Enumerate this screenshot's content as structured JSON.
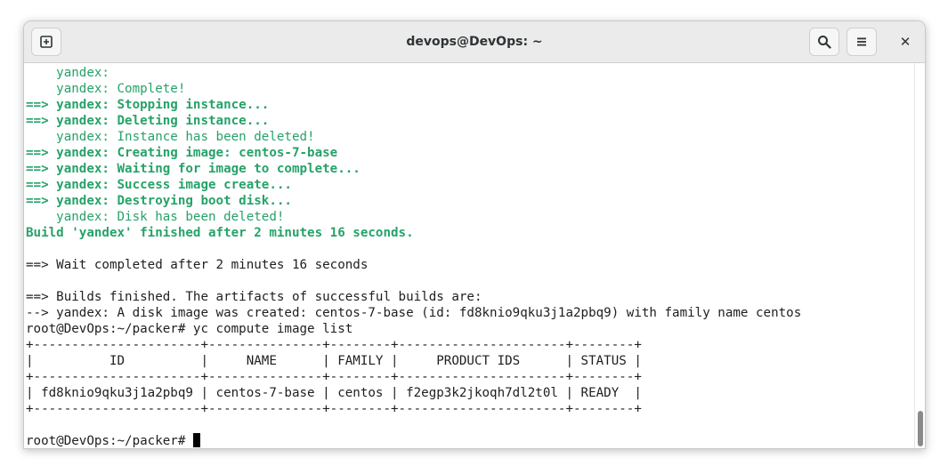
{
  "window": {
    "title": "devops@DevOps: ~"
  },
  "toolbar": {
    "new_tab_icon": "new-tab-icon",
    "search_icon": "search-icon",
    "menu_icon": "hamburger-menu-icon",
    "close_label": "✕"
  },
  "colors": {
    "terminal_green": "#26a269",
    "text": "#1e1e1e",
    "background": "#ffffff"
  },
  "terminal": {
    "lines": [
      {
        "segments": [
          {
            "text": "    yandex:",
            "style": "g"
          }
        ]
      },
      {
        "segments": [
          {
            "text": "    yandex: Complete!",
            "style": "g"
          }
        ]
      },
      {
        "segments": [
          {
            "text": "==> yandex: Stopping instance...",
            "style": "gb"
          }
        ]
      },
      {
        "segments": [
          {
            "text": "==> yandex: Deleting instance...",
            "style": "gb"
          }
        ]
      },
      {
        "segments": [
          {
            "text": "    yandex: Instance has been deleted!",
            "style": "g"
          }
        ]
      },
      {
        "segments": [
          {
            "text": "==> yandex: Creating image: centos-7-base",
            "style": "gb"
          }
        ]
      },
      {
        "segments": [
          {
            "text": "==> yandex: Waiting for image to complete...",
            "style": "gb"
          }
        ]
      },
      {
        "segments": [
          {
            "text": "==> yandex: Success image create...",
            "style": "gb"
          }
        ]
      },
      {
        "segments": [
          {
            "text": "==> yandex: Destroying boot disk...",
            "style": "gb"
          }
        ]
      },
      {
        "segments": [
          {
            "text": "    yandex: Disk has been deleted!",
            "style": "g"
          }
        ]
      },
      {
        "segments": [
          {
            "text": "Build 'yandex' finished after 2 minutes 16 seconds.",
            "style": "gb"
          }
        ]
      },
      {
        "segments": [
          {
            "text": "",
            "style": "n"
          }
        ]
      },
      {
        "segments": [
          {
            "text": "==> Wait completed after 2 minutes 16 seconds",
            "style": "n"
          }
        ]
      },
      {
        "segments": [
          {
            "text": "",
            "style": "n"
          }
        ]
      },
      {
        "segments": [
          {
            "text": "==> Builds finished. The artifacts of successful builds are:",
            "style": "n"
          }
        ]
      },
      {
        "segments": [
          {
            "text": "--> yandex: A disk image was created: centos-7-base (id: fd8knio9qku3j1a2pbq9) with family name centos",
            "style": "n"
          }
        ]
      },
      {
        "segments": [
          {
            "text": "root@DevOps:~/packer# yc compute image list",
            "style": "n"
          }
        ]
      },
      {
        "segments": [
          {
            "text": "+----------------------+---------------+--------+----------------------+--------+",
            "style": "n"
          }
        ]
      },
      {
        "segments": [
          {
            "text": "|          ID          |     NAME      | FAMILY |     PRODUCT IDS      | STATUS |",
            "style": "n"
          }
        ]
      },
      {
        "segments": [
          {
            "text": "+----------------------+---------------+--------+----------------------+--------+",
            "style": "n"
          }
        ]
      },
      {
        "segments": [
          {
            "text": "| fd8knio9qku3j1a2pbq9 | centos-7-base | centos | f2egp3k2jkoqh7dl2t0l | READY  |",
            "style": "n"
          }
        ]
      },
      {
        "segments": [
          {
            "text": "+----------------------+---------------+--------+----------------------+--------+",
            "style": "n"
          }
        ]
      },
      {
        "segments": [
          {
            "text": "",
            "style": "n"
          }
        ]
      },
      {
        "segments": [
          {
            "text": "root@DevOps:~/packer# ",
            "style": "n"
          }
        ],
        "cursor": true
      }
    ]
  }
}
